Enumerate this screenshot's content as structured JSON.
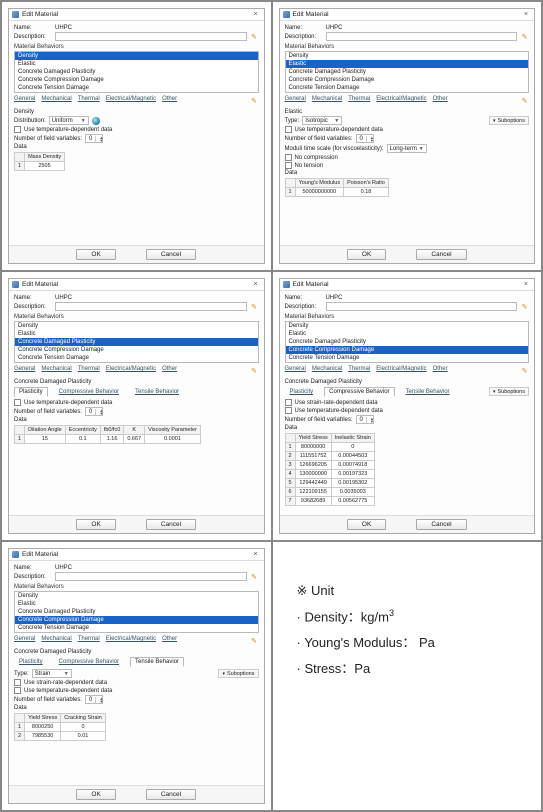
{
  "dialog_title": "Edit Material",
  "labels": {
    "name": "Name:",
    "description": "Description:",
    "material_behaviors": "Material Behaviors",
    "general": "General",
    "mechanical": "Mechanical",
    "thermal": "Thermal",
    "elecmag": "Electrical/Magnetic",
    "other": "Other",
    "ok": "OK",
    "cancel": "Cancel",
    "data": "Data",
    "suboptions": "Suboptions"
  },
  "material_name": "UHPC",
  "behaviors": [
    "Density",
    "Elastic",
    "Concrete Damaged Plasticity",
    "Concrete Compression Damage",
    "Concrete Tension Damage"
  ],
  "p1": {
    "selected": "Density",
    "panel_title": "Density",
    "distribution_label": "Distribution:",
    "distribution_value": "Uniform",
    "temp_dep": "Use temperature-dependent data",
    "field_vars_label": "Number of field variables:",
    "field_vars_value": "0",
    "col": "Mass Density",
    "row": "1",
    "value": "2505"
  },
  "p2": {
    "selected": "Elastic",
    "panel_title": "Elastic",
    "type_label": "Type:",
    "type_value": "Isotropic",
    "temp_dep": "Use temperature-dependent data",
    "field_vars_label": "Number of field variables:",
    "field_vars_value": "0",
    "moduli_label": "Moduli time scale (for viscoelasticity):",
    "moduli_value": "Long-term",
    "no_compression": "No compression",
    "no_tension": "No tension",
    "cols": [
      "Young's Modulus",
      "Poisson's Ratio"
    ],
    "row": "1",
    "values": [
      "50000000000",
      "0.18"
    ]
  },
  "p3": {
    "selected": "Concrete Damaged Plasticity",
    "panel_title": "Concrete Damaged Plasticity",
    "tabs": [
      "Plasticity",
      "Compressive Behavior",
      "Tensile Behavior"
    ],
    "temp_dep": "Use temperature-dependent data",
    "field_vars_label": "Number of field variables:",
    "field_vars_value": "0",
    "cols": [
      "Dilation Angle",
      "Eccentricity",
      "fb0/fc0",
      "K",
      "Viscosity Parameter"
    ],
    "row": "1",
    "values": [
      "15",
      "0.1",
      "1.16",
      "0.667",
      "0.0001"
    ]
  },
  "p4": {
    "selected": "Concrete Compression Damage",
    "panel_title": "Concrete Damaged Plasticity",
    "tabs": [
      "Plasticity",
      "Compressive Behavior",
      "Tensile Behavior"
    ],
    "strain_rate": "Use strain-rate-dependent data",
    "temp_dep": "Use temperature-dependent data",
    "field_vars_label": "Number of field variables:",
    "field_vars_value": "0",
    "cols": [
      "Yield Stress",
      "Inelastic Strain"
    ],
    "rows": [
      [
        "1",
        "80000000",
        "0"
      ],
      [
        "2",
        "111551752",
        "0.00044503"
      ],
      [
        "3",
        "126696205",
        "0.00074918"
      ],
      [
        "4",
        "130000000",
        "0.00197323"
      ],
      [
        "5",
        "129442449",
        "0.00195302"
      ],
      [
        "6",
        "122109155",
        "0.0035003"
      ],
      [
        "7",
        "93682689",
        "0.00562775"
      ]
    ]
  },
  "p5": {
    "selected": "Concrete Compression Damage",
    "panel_title": "Concrete Damaged Plasticity",
    "tabs": [
      "Plasticity",
      "Compressive Behavior",
      "Tensile Behavior"
    ],
    "type_label": "Type:",
    "type_value": "Strain",
    "strain_rate": "Use strain-rate-dependent data",
    "temp_dep": "Use temperature-dependent data",
    "field_vars_label": "Number of field variables:",
    "field_vars_value": "0",
    "cols": [
      "Yield Stress",
      "Cracking Strain"
    ],
    "rows": [
      [
        "1",
        "8000250",
        "0"
      ],
      [
        "2",
        "7985530",
        "0.01"
      ]
    ]
  },
  "notes": {
    "mark": "※ Unit",
    "l1": "· Density：kg/m",
    "l1sup": "3",
    "l2": "· Young's Modulus： Pa",
    "l3": "· Stress：Pa"
  }
}
